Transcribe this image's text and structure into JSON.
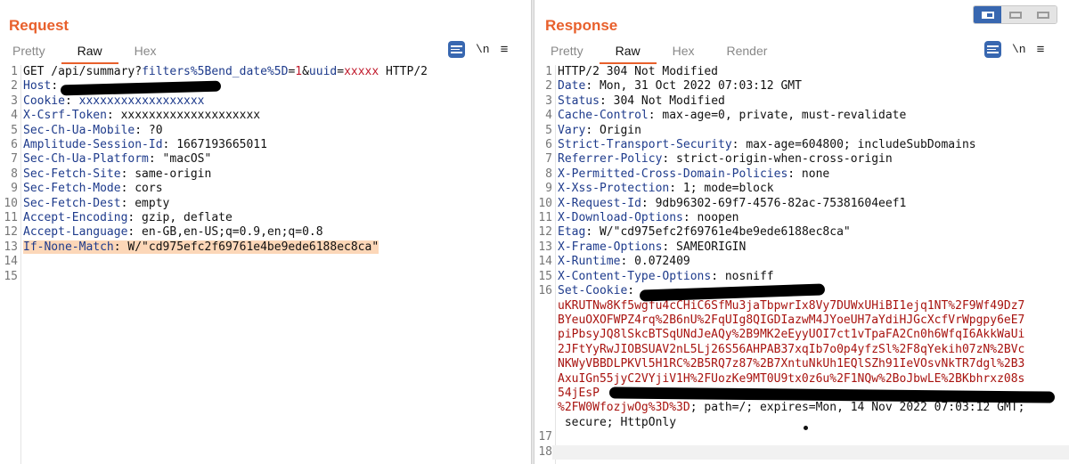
{
  "request": {
    "title": "Request",
    "tabs": [
      "Pretty",
      "Raw",
      "Hex"
    ],
    "active_tab": "Raw",
    "newline_label": "\\n",
    "lines": [
      {
        "n": "1",
        "parts": [
          [
            "GET /api/summary?",
            ""
          ],
          [
            "filters%5Bend_date%5D",
            "qkey"
          ],
          [
            "=",
            ""
          ],
          [
            "1",
            "qval"
          ],
          [
            "&",
            ""
          ],
          [
            "uuid",
            "qkey"
          ],
          [
            "=",
            ""
          ],
          [
            "xxxxx",
            "qval"
          ],
          [
            " HTTP/2",
            ""
          ]
        ]
      },
      {
        "n": "2",
        "parts": [
          [
            "Host",
            "hkey"
          ],
          [
            ": ",
            ""
          ]
        ]
      },
      {
        "n": "3",
        "parts": [
          [
            "Cookie",
            "hkey"
          ],
          [
            ": ",
            ""
          ],
          [
            "xxxxxxxxxxxxxxxxxx",
            "qkey"
          ]
        ]
      },
      {
        "n": "4",
        "parts": [
          [
            "X-Csrf-Token",
            "hkey"
          ],
          [
            ": xxxxxxxxxxxxxxxxxxxx",
            ""
          ]
        ]
      },
      {
        "n": "5",
        "parts": [
          [
            "Sec-Ch-Ua-Mobile",
            "hkey"
          ],
          [
            ": ?0",
            ""
          ]
        ]
      },
      {
        "n": "6",
        "parts": [
          [
            "Amplitude-Session-Id",
            "hkey"
          ],
          [
            ": 1667193665011",
            ""
          ]
        ]
      },
      {
        "n": "7",
        "parts": [
          [
            "Sec-Ch-Ua-Platform",
            "hkey"
          ],
          [
            ": \"macOS\"",
            ""
          ]
        ]
      },
      {
        "n": "8",
        "parts": [
          [
            "Sec-Fetch-Site",
            "hkey"
          ],
          [
            ": same-origin",
            ""
          ]
        ]
      },
      {
        "n": "9",
        "parts": [
          [
            "Sec-Fetch-Mode",
            "hkey"
          ],
          [
            ": cors",
            ""
          ]
        ]
      },
      {
        "n": "10",
        "parts": [
          [
            "Sec-Fetch-Dest",
            "hkey"
          ],
          [
            ": empty",
            ""
          ]
        ]
      },
      {
        "n": "11",
        "parts": [
          [
            "Accept-Encoding",
            "hkey"
          ],
          [
            ": gzip, deflate",
            ""
          ]
        ]
      },
      {
        "n": "12",
        "parts": [
          [
            "Accept-Language",
            "hkey"
          ],
          [
            ": en-GB,en-US;q=0.9,en;q=0.8",
            ""
          ]
        ]
      },
      {
        "n": "13",
        "highlight": true,
        "parts": [
          [
            "If-None-Match",
            "hkey"
          ],
          [
            ": W/\"cd975efc2f69761e4be9ede6188ec8ca\"",
            ""
          ]
        ]
      },
      {
        "n": "14",
        "parts": []
      },
      {
        "n": "15",
        "parts": []
      }
    ]
  },
  "response": {
    "title": "Response",
    "tabs": [
      "Pretty",
      "Raw",
      "Hex",
      "Render"
    ],
    "active_tab": "Raw",
    "newline_label": "\\n",
    "lines": [
      {
        "n": "1",
        "parts": [
          [
            "HTTP/2 304 Not Modified",
            ""
          ]
        ]
      },
      {
        "n": "2",
        "parts": [
          [
            "Date",
            "hkey"
          ],
          [
            ": Mon, 31 Oct 2022 07:03:12 GMT",
            ""
          ]
        ]
      },
      {
        "n": "3",
        "parts": [
          [
            "Status",
            "hkey"
          ],
          [
            ": 304 Not Modified",
            ""
          ]
        ]
      },
      {
        "n": "4",
        "parts": [
          [
            "Cache-Control",
            "hkey"
          ],
          [
            ": max-age=0, private, must-revalidate",
            ""
          ]
        ]
      },
      {
        "n": "5",
        "parts": [
          [
            "Vary",
            "hkey"
          ],
          [
            ": Origin",
            ""
          ]
        ]
      },
      {
        "n": "6",
        "parts": [
          [
            "Strict-Transport-Security",
            "hkey"
          ],
          [
            ": max-age=604800; includeSubDomains",
            ""
          ]
        ]
      },
      {
        "n": "7",
        "parts": [
          [
            "Referrer-Policy",
            "hkey"
          ],
          [
            ": strict-origin-when-cross-origin",
            ""
          ]
        ]
      },
      {
        "n": "8",
        "parts": [
          [
            "X-Permitted-Cross-Domain-Policies",
            "hkey"
          ],
          [
            ": none",
            ""
          ]
        ]
      },
      {
        "n": "9",
        "parts": [
          [
            "X-Xss-Protection",
            "hkey"
          ],
          [
            ": 1; mode=block",
            ""
          ]
        ]
      },
      {
        "n": "10",
        "parts": [
          [
            "X-Request-Id",
            "hkey"
          ],
          [
            ": 9db96302-69f7-4576-82ac-75381604eef1",
            ""
          ]
        ]
      },
      {
        "n": "11",
        "parts": [
          [
            "X-Download-Options",
            "hkey"
          ],
          [
            ": noopen",
            ""
          ]
        ]
      },
      {
        "n": "12",
        "parts": [
          [
            "Etag",
            "hkey"
          ],
          [
            ": W/\"cd975efc2f69761e4be9ede6188ec8ca\"",
            ""
          ]
        ]
      },
      {
        "n": "13",
        "parts": [
          [
            "X-Frame-Options",
            "hkey"
          ],
          [
            ": SAMEORIGIN",
            ""
          ]
        ]
      },
      {
        "n": "14",
        "parts": [
          [
            "X-Runtime",
            "hkey"
          ],
          [
            ": 0.072409",
            ""
          ]
        ]
      },
      {
        "n": "15",
        "parts": [
          [
            "X-Content-Type-Options",
            "hkey"
          ],
          [
            ": nosniff",
            ""
          ]
        ]
      },
      {
        "n": "16",
        "parts": [
          [
            "Set-Cookie",
            "hkey"
          ],
          [
            ":",
            ""
          ]
        ]
      },
      {
        "n": "",
        "parts": [
          [
            "uKRUTNw8Kf5wgfu4cCHiC6SfMu3jaTbpwrIx8Vy7DUWxUHiBI1ejq1NT%2F9Wf49Dz7",
            "ck"
          ]
        ]
      },
      {
        "n": "",
        "parts": [
          [
            "BYeuOXOFWPZ4rq%2B6nU%2FqUIg8QIGDIazwM4JYoeUH7aYdiHJGcXcfVrWpgpy6eE7",
            "ck"
          ]
        ]
      },
      {
        "n": "",
        "parts": [
          [
            "piPbsyJQ8lSkcBTSqUNdJeAQy%2B9MK2eEyyUOI7ct1vTpaFA2Cn0h6WfqI6AkkWaUi",
            "ck"
          ]
        ]
      },
      {
        "n": "",
        "parts": [
          [
            "2JFtYyRwJIOBSUAV2nL5Lj26S56AHPAB37xqIb7o0p4yfzSl%2F8qYekih07zN%2BVc",
            "ck"
          ]
        ]
      },
      {
        "n": "",
        "parts": [
          [
            "NKWyVBBDLPKVl5H1RC%2B5RQ7z87%2B7XntuNkUh1EQlSZh91IeVOsvNkTR7dgl%2B3",
            "ck"
          ]
        ]
      },
      {
        "n": "",
        "parts": [
          [
            "AxuIGn55jyC2VYjiV1H%2FUozKe9MT0U9tx0z6u%2F1NQw%2BoJbwLE%2BKbhrxz08s",
            "ck"
          ]
        ]
      },
      {
        "n": "",
        "parts": [
          [
            "54jEsP",
            "ck"
          ]
        ]
      },
      {
        "n": "",
        "parts": [
          [
            "%2FW0WfozjwOg%3D%3D",
            "ck"
          ],
          [
            "; path=/; expires=Mon, 14 Nov 2022 07:03:12 GMT;",
            ""
          ]
        ]
      },
      {
        "n": "",
        "parts": [
          [
            " secure; HttpOnly",
            ""
          ]
        ]
      },
      {
        "n": "17",
        "parts": []
      },
      {
        "n": "18",
        "empty_bg": true,
        "parts": []
      }
    ]
  },
  "colors": {
    "accent": "#e8602c",
    "header_key": "#1e3b8c",
    "query_value": "#c0192b",
    "cookie_value": "#a8130f",
    "highlight": "#fcd7b8",
    "button_blue": "#3867b0"
  },
  "icons": {
    "wrap": "word-wrap-icon",
    "menu": "hamburger-menu-icon",
    "layout": "layout-toggle-icon"
  }
}
